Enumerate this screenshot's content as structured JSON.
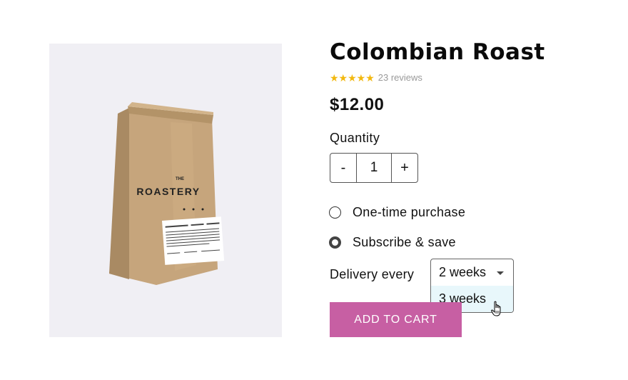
{
  "product": {
    "title": "Colombian Roast",
    "rating_stars": "★★★★★",
    "reviews": "23 reviews",
    "price": "$12.00",
    "image_icon": "coffee-bag",
    "bag_brand": "THE",
    "bag_name": "ROASTERY",
    "bag_label_title": "COLOMBIAN ROAST"
  },
  "quantity": {
    "label": "Quantity",
    "minus": "-",
    "plus": "+",
    "value": "1"
  },
  "purchase_options": [
    {
      "label": "One-time purchase",
      "selected": false
    },
    {
      "label": "Subscribe & save",
      "selected": true
    }
  ],
  "delivery": {
    "label": "Delivery every",
    "selected": "2 weeks",
    "highlighted_option": "3 weeks"
  },
  "cart": {
    "label": "ADD TO CART"
  },
  "colors": {
    "accent": "#c75fa3",
    "star": "#f2b80f",
    "option_highlight": "#e8f7fb",
    "image_bg": "#f0eff4"
  }
}
